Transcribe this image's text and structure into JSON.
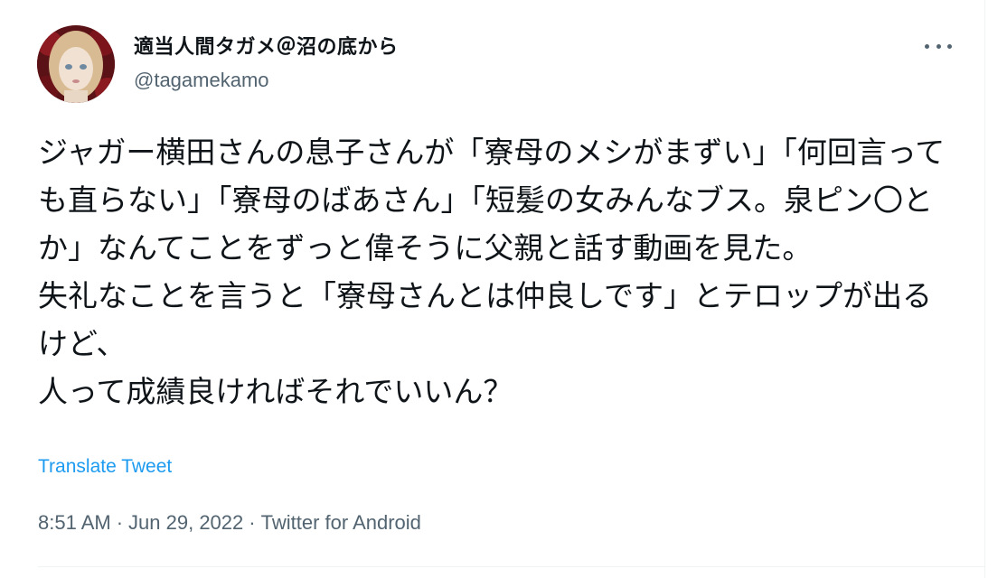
{
  "user": {
    "display_name": "適当人間タガメ＠沼の底から",
    "handle": "@tagamekamo"
  },
  "tweet": {
    "text": "ジャガー横田さんの息子さんが「寮母のメシがまずい」「何回言っても直らない」「寮母のばあさん」「短髪の女みんなブス。泉ピン〇とか」なんてことをずっと偉そうに父親と話す動画を見た。\n失礼なことを言うと「寮母さんとは仲良しです」とテロップが出るけど、\n人って成績良ければそれでいいん？",
    "translate_label": "Translate Tweet"
  },
  "meta": {
    "time": "8:51 AM",
    "separator": "·",
    "date": "Jun 29, 2022",
    "source": "Twitter for Android"
  },
  "icons": {
    "avatar": "doll-avatar",
    "more": "more-options-icon"
  },
  "colors": {
    "text": "#0f1419",
    "secondary": "#536471",
    "link": "#1d9bf0"
  }
}
